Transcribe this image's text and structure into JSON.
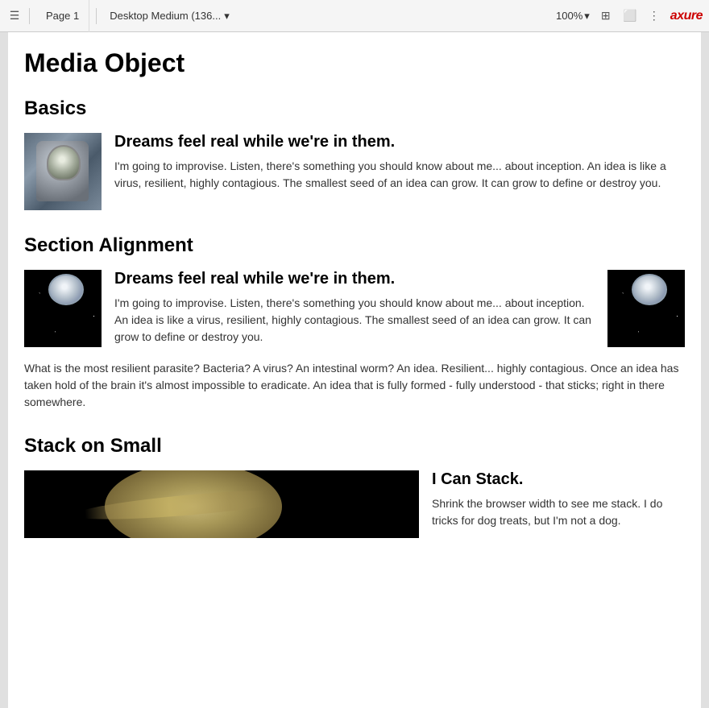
{
  "toolbar": {
    "hamburger_label": "☰",
    "page_tab": "Page 1",
    "viewport": "Desktop Medium (136...",
    "chevron": "▾",
    "zoom": "100%",
    "zoom_chevron": "▾",
    "icon_grid": "⊞",
    "icon_frame": "⬜",
    "icon_more": "⋮",
    "axure_logo": "axure"
  },
  "page": {
    "title": "Media Object",
    "sections": [
      {
        "id": "basics",
        "title": "Basics",
        "items": [
          {
            "heading": "Dreams feel real while we're in them.",
            "body": "I'm going to improvise. Listen, there's something you should know about me... about inception. An idea is like a virus, resilient, highly contagious. The smallest seed of an idea can grow. It can grow to define or destroy you."
          }
        ]
      },
      {
        "id": "section-alignment",
        "title": "Section Alignment",
        "items": [
          {
            "heading": "Dreams feel real while we're in them.",
            "body": "I'm going to improvise. Listen, there's something you should know about me... about inception. An idea is like a virus, resilient, highly contagious. The smallest seed of an idea can grow. It can grow to define or destroy you.",
            "extra": "What is the most resilient parasite? Bacteria? A virus? An intestinal worm? An idea. Resilient... highly contagious. Once an idea has taken hold of the brain it's almost impossible to eradicate. An idea that is fully formed - fully understood - that sticks; right in there somewhere."
          }
        ]
      },
      {
        "id": "stack-on-small",
        "title": "Stack on Small",
        "items": [
          {
            "heading": "I Can Stack.",
            "body": "Shrink the browser width to see me stack. I do tricks for dog treats, but I'm not a dog."
          }
        ]
      }
    ]
  }
}
